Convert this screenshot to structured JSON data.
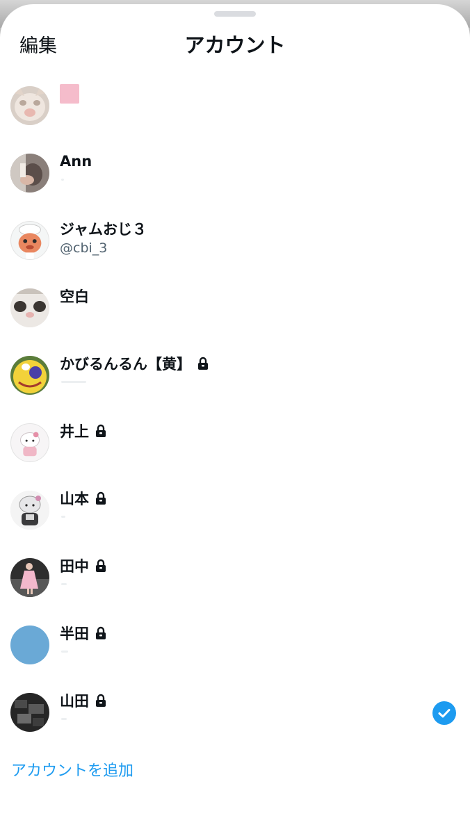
{
  "header": {
    "edit_label": "編集",
    "title": "アカウント"
  },
  "accounts": [
    {
      "name": "",
      "handle": "",
      "locked": false,
      "selected": false,
      "avatar": "cat-photo"
    },
    {
      "name": "Ann",
      "handle": "",
      "locked": false,
      "selected": false,
      "avatar": "person-photo"
    },
    {
      "name": "ジャムおじ３",
      "handle": "@cbi_3",
      "locked": false,
      "selected": false,
      "avatar": "cartoon-baker"
    },
    {
      "name": "空白",
      "handle": "",
      "locked": false,
      "selected": false,
      "avatar": "white-cat-face"
    },
    {
      "name": "かびるんるん【黄】",
      "handle": "",
      "locked": true,
      "selected": false,
      "avatar": "yellow-character"
    },
    {
      "name": "井上",
      "handle": "",
      "locked": true,
      "selected": false,
      "avatar": "hello-kitty"
    },
    {
      "name": "山本",
      "handle": "",
      "locked": true,
      "selected": false,
      "avatar": "kitty-figure"
    },
    {
      "name": "田中",
      "handle": "",
      "locked": true,
      "selected": false,
      "avatar": "person-pink-dress"
    },
    {
      "name": "半田",
      "handle": "",
      "locked": true,
      "selected": false,
      "avatar": "solid-blue"
    },
    {
      "name": "山田",
      "handle": "",
      "locked": true,
      "selected": true,
      "avatar": "dark-photo"
    }
  ],
  "footer": {
    "add_account_label": "アカウントを追加"
  },
  "colors": {
    "accent": "#1d9bf0",
    "text_primary": "#0f1419",
    "text_secondary": "#536471",
    "avatar_blue": "#6aa9d6"
  },
  "icons": {
    "lock": "lock-icon",
    "selected": "check-circle-icon"
  }
}
